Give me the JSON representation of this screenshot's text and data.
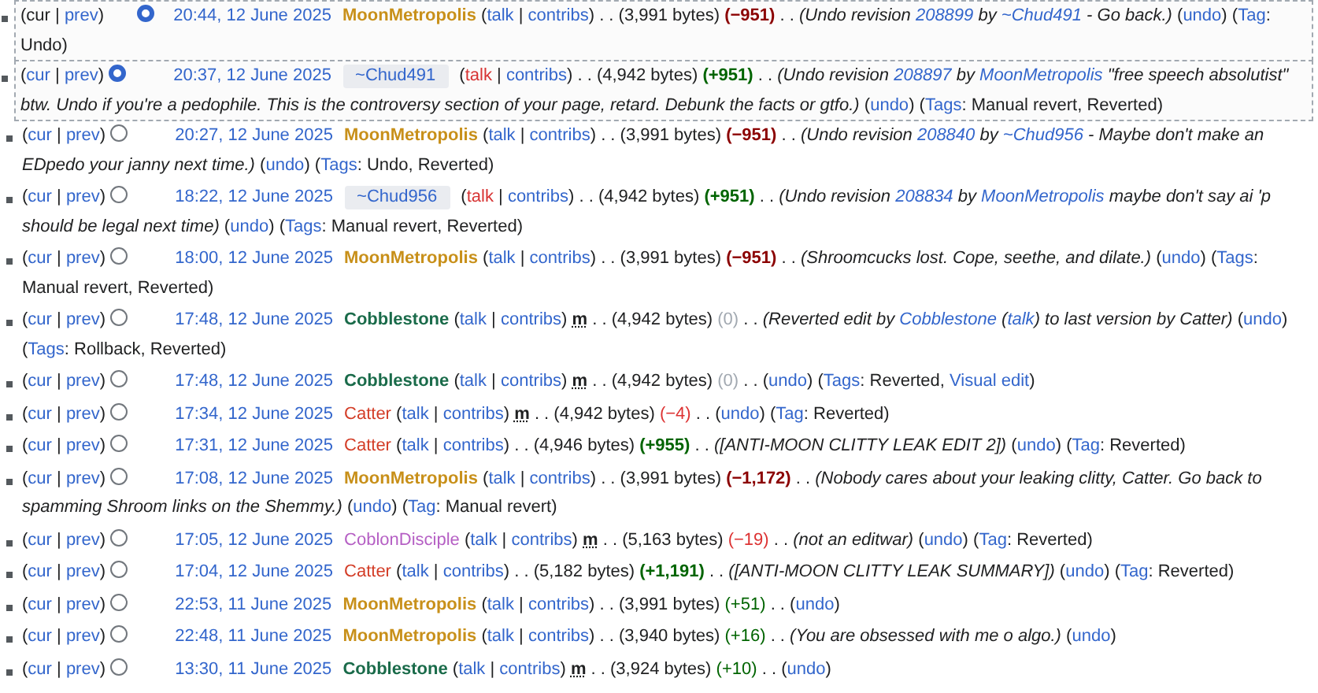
{
  "rows": [
    {
      "selected": true,
      "nav": [
        {
          "text": "(",
          "kind": "plain"
        },
        {
          "text": "cur",
          "kind": "plain"
        },
        {
          "text": " | ",
          "kind": "plain"
        },
        {
          "text": "prev",
          "kind": "link"
        },
        {
          "text": ")",
          "kind": "plain"
        }
      ],
      "radio_in_new_column": true,
      "radio_checked": true,
      "date": "20:44, 12 June 2025",
      "user": {
        "name": "MoonMetropolis",
        "kind": "registered",
        "color": "#c8901a"
      },
      "tools": [
        {
          "text": "(",
          "kind": "plain"
        },
        {
          "text": "talk",
          "kind": "link"
        },
        {
          "text": " | ",
          "kind": "plain"
        },
        {
          "text": "contribs",
          "kind": "link"
        },
        {
          "text": ")",
          "kind": "plain"
        }
      ],
      "separators": [
        ". .",
        ". ."
      ],
      "size": "(3,991 bytes)",
      "diff": {
        "text": "(−951)",
        "kind": "negative",
        "big": true
      },
      "summary": [
        {
          "text": "(Undo revision ",
          "kind": "plain"
        },
        {
          "text": "208899",
          "kind": "link"
        },
        {
          "text": " by ",
          "kind": "plain"
        },
        {
          "text": "~Chud491",
          "kind": "link"
        },
        {
          "text": " - Go back.)",
          "kind": "plain"
        }
      ],
      "undo": [
        {
          "text": "(",
          "kind": "plain"
        },
        {
          "text": "undo",
          "kind": "link"
        },
        {
          "text": ")",
          "kind": "plain"
        }
      ],
      "tags": [
        {
          "text": "(",
          "kind": "plain"
        },
        {
          "text": "Tag",
          "kind": "link"
        },
        {
          "text": ": Undo)",
          "kind": "plain"
        }
      ]
    },
    {
      "selected": true,
      "nav": [
        {
          "text": "(",
          "kind": "plain"
        },
        {
          "text": "cur",
          "kind": "link"
        },
        {
          "text": " | ",
          "kind": "plain"
        },
        {
          "text": "prev",
          "kind": "link"
        },
        {
          "text": ")",
          "kind": "plain"
        }
      ],
      "radio_in_new_column": false,
      "radio_checked": true,
      "date": "20:37, 12 June 2025",
      "user": {
        "name": "~Chud491",
        "kind": "temporary",
        "color": "#3366cc"
      },
      "tools": [
        {
          "text": "(",
          "kind": "plain"
        },
        {
          "text": "talk",
          "kind": "redlink"
        },
        {
          "text": " | ",
          "kind": "plain"
        },
        {
          "text": "contribs",
          "kind": "link"
        },
        {
          "text": ")",
          "kind": "plain"
        }
      ],
      "separators": [
        ". .",
        ". ."
      ],
      "size": "(4,942 bytes)",
      "diff": {
        "text": "(+951)",
        "kind": "positive",
        "big": true
      },
      "summary": [
        {
          "text": "(Undo revision ",
          "kind": "plain"
        },
        {
          "text": "208897",
          "kind": "link"
        },
        {
          "text": " by ",
          "kind": "plain"
        },
        {
          "text": "MoonMetropolis",
          "kind": "link"
        },
        {
          "text": " \"free speech absolutist\" btw. Undo if you're a pedophile. This is the controversy section of your page, retard. Debunk the facts or gtfo.)",
          "kind": "plain"
        }
      ],
      "undo": [
        {
          "text": "(",
          "kind": "plain"
        },
        {
          "text": "undo",
          "kind": "link"
        },
        {
          "text": ")",
          "kind": "plain"
        }
      ],
      "tags": [
        {
          "text": "(",
          "kind": "plain"
        },
        {
          "text": "Tags",
          "kind": "link"
        },
        {
          "text": ": Manual revert, Reverted)",
          "kind": "plain"
        }
      ]
    },
    {
      "selected": false,
      "nav": [
        {
          "text": "(",
          "kind": "plain"
        },
        {
          "text": "cur",
          "kind": "link"
        },
        {
          "text": " | ",
          "kind": "plain"
        },
        {
          "text": "prev",
          "kind": "link"
        },
        {
          "text": ")",
          "kind": "plain"
        }
      ],
      "radio_in_new_column": false,
      "radio_checked": false,
      "date": "20:27, 12 June 2025",
      "user": {
        "name": "MoonMetropolis",
        "kind": "registered",
        "color": "#c8901a"
      },
      "tools": [
        {
          "text": "(",
          "kind": "plain"
        },
        {
          "text": "talk",
          "kind": "link"
        },
        {
          "text": " | ",
          "kind": "plain"
        },
        {
          "text": "contribs",
          "kind": "link"
        },
        {
          "text": ")",
          "kind": "plain"
        }
      ],
      "separators": [
        ". .",
        ". ."
      ],
      "size": "(3,991 bytes)",
      "diff": {
        "text": "(−951)",
        "kind": "negative",
        "big": true
      },
      "summary": [
        {
          "text": "(Undo revision ",
          "kind": "plain"
        },
        {
          "text": "208840",
          "kind": "link"
        },
        {
          "text": " by ",
          "kind": "plain"
        },
        {
          "text": "~Chud956",
          "kind": "link"
        },
        {
          "text": " - Maybe don't make an EDpedo your janny next time.)",
          "kind": "plain"
        }
      ],
      "undo": [
        {
          "text": "(",
          "kind": "plain"
        },
        {
          "text": "undo",
          "kind": "link"
        },
        {
          "text": ")",
          "kind": "plain"
        }
      ],
      "tags": [
        {
          "text": "(",
          "kind": "plain"
        },
        {
          "text": "Tags",
          "kind": "link"
        },
        {
          "text": ": Undo, Reverted)",
          "kind": "plain"
        }
      ]
    },
    {
      "selected": false,
      "nav": [
        {
          "text": "(",
          "kind": "plain"
        },
        {
          "text": "cur",
          "kind": "link"
        },
        {
          "text": " | ",
          "kind": "plain"
        },
        {
          "text": "prev",
          "kind": "link"
        },
        {
          "text": ")",
          "kind": "plain"
        }
      ],
      "radio_in_new_column": false,
      "radio_checked": false,
      "date": "18:22, 12 June 2025",
      "user": {
        "name": "~Chud956",
        "kind": "temporary",
        "color": "#3366cc"
      },
      "tools": [
        {
          "text": "(",
          "kind": "plain"
        },
        {
          "text": "talk",
          "kind": "redlink"
        },
        {
          "text": " | ",
          "kind": "plain"
        },
        {
          "text": "contribs",
          "kind": "link"
        },
        {
          "text": ")",
          "kind": "plain"
        }
      ],
      "separators": [
        ". .",
        ". ."
      ],
      "size": "(4,942 bytes)",
      "diff": {
        "text": "(+951)",
        "kind": "positive",
        "big": true
      },
      "summary": [
        {
          "text": "(Undo revision ",
          "kind": "plain"
        },
        {
          "text": "208834",
          "kind": "link"
        },
        {
          "text": " by ",
          "kind": "plain"
        },
        {
          "text": "MoonMetropolis",
          "kind": "link"
        },
        {
          "text": " maybe don't say ai 'p should be legal next time)",
          "kind": "plain"
        }
      ],
      "undo": [
        {
          "text": "(",
          "kind": "plain"
        },
        {
          "text": "undo",
          "kind": "link"
        },
        {
          "text": ")",
          "kind": "plain"
        }
      ],
      "tags": [
        {
          "text": "(",
          "kind": "plain"
        },
        {
          "text": "Tags",
          "kind": "link"
        },
        {
          "text": ": Manual revert, Reverted)",
          "kind": "plain"
        }
      ]
    },
    {
      "selected": false,
      "nav": [
        {
          "text": "(",
          "kind": "plain"
        },
        {
          "text": "cur",
          "kind": "link"
        },
        {
          "text": " | ",
          "kind": "plain"
        },
        {
          "text": "prev",
          "kind": "link"
        },
        {
          "text": ")",
          "kind": "plain"
        }
      ],
      "radio_in_new_column": false,
      "radio_checked": false,
      "date": "18:00, 12 June 2025",
      "user": {
        "name": "MoonMetropolis",
        "kind": "registered",
        "color": "#c8901a"
      },
      "tools": [
        {
          "text": "(",
          "kind": "plain"
        },
        {
          "text": "talk",
          "kind": "link"
        },
        {
          "text": " | ",
          "kind": "plain"
        },
        {
          "text": "contribs",
          "kind": "link"
        },
        {
          "text": ")",
          "kind": "plain"
        }
      ],
      "separators": [
        ". .",
        ". ."
      ],
      "size": "(3,991 bytes)",
      "diff": {
        "text": "(−951)",
        "kind": "negative",
        "big": true
      },
      "summary": [
        {
          "text": "(Shroomcucks lost. Cope, seethe, and dilate.)",
          "kind": "plain"
        }
      ],
      "undo": [
        {
          "text": "(",
          "kind": "plain"
        },
        {
          "text": "undo",
          "kind": "link"
        },
        {
          "text": ")",
          "kind": "plain"
        }
      ],
      "tags": [
        {
          "text": "(",
          "kind": "plain"
        },
        {
          "text": "Tags",
          "kind": "link"
        },
        {
          "text": ": Manual revert, Reverted)",
          "kind": "plain"
        }
      ]
    },
    {
      "selected": false,
      "nav": [
        {
          "text": "(",
          "kind": "plain"
        },
        {
          "text": "cur",
          "kind": "link"
        },
        {
          "text": " | ",
          "kind": "plain"
        },
        {
          "text": "prev",
          "kind": "link"
        },
        {
          "text": ")",
          "kind": "plain"
        }
      ],
      "radio_in_new_column": false,
      "radio_checked": false,
      "date": "17:48, 12 June 2025",
      "user": {
        "name": "Cobblestone",
        "kind": "registered",
        "color": "#1a6b4a"
      },
      "tools": [
        {
          "text": "(",
          "kind": "plain"
        },
        {
          "text": "talk",
          "kind": "link"
        },
        {
          "text": " | ",
          "kind": "plain"
        },
        {
          "text": "contribs",
          "kind": "link"
        },
        {
          "text": ")",
          "kind": "plain"
        }
      ],
      "minor": "m",
      "separators": [
        ". .",
        ". ."
      ],
      "size": "(4,942 bytes)",
      "diff": {
        "text": "(0)",
        "kind": "zero",
        "big": false
      },
      "summary": [
        {
          "text": "(Reverted edit by ",
          "kind": "plain"
        },
        {
          "text": "Cobblestone",
          "kind": "link"
        },
        {
          "text": " (",
          "kind": "plain"
        },
        {
          "text": "talk",
          "kind": "link"
        },
        {
          "text": ") to last version by Catter)",
          "kind": "plain"
        }
      ],
      "undo": [
        {
          "text": "(",
          "kind": "plain"
        },
        {
          "text": "undo",
          "kind": "link"
        },
        {
          "text": ")",
          "kind": "plain"
        }
      ],
      "tags": [
        {
          "text": "(",
          "kind": "plain"
        },
        {
          "text": "Tags",
          "kind": "link"
        },
        {
          "text": ": Rollback, Reverted)",
          "kind": "plain"
        }
      ]
    },
    {
      "selected": false,
      "nav": [
        {
          "text": "(",
          "kind": "plain"
        },
        {
          "text": "cur",
          "kind": "link"
        },
        {
          "text": " | ",
          "kind": "plain"
        },
        {
          "text": "prev",
          "kind": "link"
        },
        {
          "text": ")",
          "kind": "plain"
        }
      ],
      "radio_in_new_column": false,
      "radio_checked": false,
      "date": "17:48, 12 June 2025",
      "user": {
        "name": "Cobblestone",
        "kind": "registered",
        "color": "#1a6b4a"
      },
      "tools": [
        {
          "text": "(",
          "kind": "plain"
        },
        {
          "text": "talk",
          "kind": "link"
        },
        {
          "text": " | ",
          "kind": "plain"
        },
        {
          "text": "contribs",
          "kind": "link"
        },
        {
          "text": ")",
          "kind": "plain"
        }
      ],
      "minor": "m",
      "separators": [
        ". .",
        ". ."
      ],
      "size": "(4,942 bytes)",
      "diff": {
        "text": "(0)",
        "kind": "zero",
        "big": false
      },
      "undo": [
        {
          "text": "(",
          "kind": "plain"
        },
        {
          "text": "undo",
          "kind": "link"
        },
        {
          "text": ")",
          "kind": "plain"
        }
      ],
      "tags": [
        {
          "text": "(",
          "kind": "plain"
        },
        {
          "text": "Tags",
          "kind": "link"
        },
        {
          "text": ": Reverted, ",
          "kind": "plain"
        },
        {
          "text": "Visual edit",
          "kind": "link"
        },
        {
          "text": ")",
          "kind": "plain"
        }
      ]
    },
    {
      "selected": false,
      "nav": [
        {
          "text": "(",
          "kind": "plain"
        },
        {
          "text": "cur",
          "kind": "link"
        },
        {
          "text": " | ",
          "kind": "plain"
        },
        {
          "text": "prev",
          "kind": "link"
        },
        {
          "text": ")",
          "kind": "plain"
        }
      ],
      "radio_in_new_column": false,
      "radio_checked": false,
      "date": "17:34, 12 June 2025",
      "user": {
        "name": "Catter",
        "kind": "plain",
        "color": "#d33c26"
      },
      "tools": [
        {
          "text": "(",
          "kind": "plain"
        },
        {
          "text": "talk",
          "kind": "link"
        },
        {
          "text": " | ",
          "kind": "plain"
        },
        {
          "text": "contribs",
          "kind": "link"
        },
        {
          "text": ")",
          "kind": "plain"
        }
      ],
      "minor": "m",
      "separators": [
        ". .",
        ". ."
      ],
      "size": "(4,942 bytes)",
      "diff": {
        "text": "(−4)",
        "kind": "negative",
        "big": false
      },
      "undo": [
        {
          "text": "(",
          "kind": "plain"
        },
        {
          "text": "undo",
          "kind": "link"
        },
        {
          "text": ")",
          "kind": "plain"
        }
      ],
      "tags": [
        {
          "text": "(",
          "kind": "plain"
        },
        {
          "text": "Tag",
          "kind": "link"
        },
        {
          "text": ": Reverted)",
          "kind": "plain"
        }
      ]
    },
    {
      "selected": false,
      "nav": [
        {
          "text": "(",
          "kind": "plain"
        },
        {
          "text": "cur",
          "kind": "link"
        },
        {
          "text": " | ",
          "kind": "plain"
        },
        {
          "text": "prev",
          "kind": "link"
        },
        {
          "text": ")",
          "kind": "plain"
        }
      ],
      "radio_in_new_column": false,
      "radio_checked": false,
      "date": "17:31, 12 June 2025",
      "user": {
        "name": "Catter",
        "kind": "plain",
        "color": "#d33c26"
      },
      "tools": [
        {
          "text": "(",
          "kind": "plain"
        },
        {
          "text": "talk",
          "kind": "link"
        },
        {
          "text": " | ",
          "kind": "plain"
        },
        {
          "text": "contribs",
          "kind": "link"
        },
        {
          "text": ")",
          "kind": "plain"
        }
      ],
      "separators": [
        ". .",
        ". ."
      ],
      "size": "(4,946 bytes)",
      "diff": {
        "text": "(+955)",
        "kind": "positive",
        "big": true
      },
      "summary": [
        {
          "text": "([ANTI-MOON CLITTY LEAK EDIT 2])",
          "kind": "plain"
        }
      ],
      "undo": [
        {
          "text": "(",
          "kind": "plain"
        },
        {
          "text": "undo",
          "kind": "link"
        },
        {
          "text": ")",
          "kind": "plain"
        }
      ],
      "tags": [
        {
          "text": "(",
          "kind": "plain"
        },
        {
          "text": "Tag",
          "kind": "link"
        },
        {
          "text": ": Reverted)",
          "kind": "plain"
        }
      ]
    },
    {
      "selected": false,
      "nav": [
        {
          "text": "(",
          "kind": "plain"
        },
        {
          "text": "cur",
          "kind": "link"
        },
        {
          "text": " | ",
          "kind": "plain"
        },
        {
          "text": "prev",
          "kind": "link"
        },
        {
          "text": ")",
          "kind": "plain"
        }
      ],
      "radio_in_new_column": false,
      "radio_checked": false,
      "date": "17:08, 12 June 2025",
      "user": {
        "name": "MoonMetropolis",
        "kind": "registered",
        "color": "#c8901a"
      },
      "tools": [
        {
          "text": "(",
          "kind": "plain"
        },
        {
          "text": "talk",
          "kind": "link"
        },
        {
          "text": " | ",
          "kind": "plain"
        },
        {
          "text": "contribs",
          "kind": "link"
        },
        {
          "text": ")",
          "kind": "plain"
        }
      ],
      "separators": [
        ". .",
        ". ."
      ],
      "size": "(3,991 bytes)",
      "diff": {
        "text": "(−1,172)",
        "kind": "negative",
        "big": true
      },
      "summary": [
        {
          "text": "(Nobody cares about your leaking clitty, Catter. Go back to spamming Shroom links on the Shemmy.)",
          "kind": "plain"
        }
      ],
      "undo": [
        {
          "text": "(",
          "kind": "plain"
        },
        {
          "text": "undo",
          "kind": "link"
        },
        {
          "text": ")",
          "kind": "plain"
        }
      ],
      "tags": [
        {
          "text": "(",
          "kind": "plain"
        },
        {
          "text": "Tag",
          "kind": "link"
        },
        {
          "text": ": Manual revert)",
          "kind": "plain"
        }
      ]
    },
    {
      "selected": false,
      "nav": [
        {
          "text": "(",
          "kind": "plain"
        },
        {
          "text": "cur",
          "kind": "link"
        },
        {
          "text": " | ",
          "kind": "plain"
        },
        {
          "text": "prev",
          "kind": "link"
        },
        {
          "text": ")",
          "kind": "plain"
        }
      ],
      "radio_in_new_column": false,
      "radio_checked": false,
      "date": "17:05, 12 June 2025",
      "user": {
        "name": "CoblonDisciple",
        "kind": "plain",
        "color": "#b55fc4"
      },
      "tools": [
        {
          "text": "(",
          "kind": "plain"
        },
        {
          "text": "talk",
          "kind": "link"
        },
        {
          "text": " | ",
          "kind": "plain"
        },
        {
          "text": "contribs",
          "kind": "link"
        },
        {
          "text": ")",
          "kind": "plain"
        }
      ],
      "minor": "m",
      "separators": [
        ". .",
        ". ."
      ],
      "size": "(5,163 bytes)",
      "diff": {
        "text": "(−19)",
        "kind": "negative",
        "big": false
      },
      "summary": [
        {
          "text": "(not an editwar)",
          "kind": "plain"
        }
      ],
      "undo": [
        {
          "text": "(",
          "kind": "plain"
        },
        {
          "text": "undo",
          "kind": "link"
        },
        {
          "text": ")",
          "kind": "plain"
        }
      ],
      "tags": [
        {
          "text": "(",
          "kind": "plain"
        },
        {
          "text": "Tag",
          "kind": "link"
        },
        {
          "text": ": Reverted)",
          "kind": "plain"
        }
      ]
    },
    {
      "selected": false,
      "nav": [
        {
          "text": "(",
          "kind": "plain"
        },
        {
          "text": "cur",
          "kind": "link"
        },
        {
          "text": " | ",
          "kind": "plain"
        },
        {
          "text": "prev",
          "kind": "link"
        },
        {
          "text": ")",
          "kind": "plain"
        }
      ],
      "radio_in_new_column": false,
      "radio_checked": false,
      "date": "17:04, 12 June 2025",
      "user": {
        "name": "Catter",
        "kind": "plain",
        "color": "#d33c26"
      },
      "tools": [
        {
          "text": "(",
          "kind": "plain"
        },
        {
          "text": "talk",
          "kind": "link"
        },
        {
          "text": " | ",
          "kind": "plain"
        },
        {
          "text": "contribs",
          "kind": "link"
        },
        {
          "text": ")",
          "kind": "plain"
        }
      ],
      "separators": [
        ". .",
        ". ."
      ],
      "size": "(5,182 bytes)",
      "diff": {
        "text": "(+1,191)",
        "kind": "positive",
        "big": true
      },
      "summary": [
        {
          "text": "([ANTI-MOON CLITTY LEAK SUMMARY])",
          "kind": "plain"
        }
      ],
      "undo": [
        {
          "text": "(",
          "kind": "plain"
        },
        {
          "text": "undo",
          "kind": "link"
        },
        {
          "text": ")",
          "kind": "plain"
        }
      ],
      "tags": [
        {
          "text": "(",
          "kind": "plain"
        },
        {
          "text": "Tag",
          "kind": "link"
        },
        {
          "text": ": Reverted)",
          "kind": "plain"
        }
      ]
    },
    {
      "selected": false,
      "nav": [
        {
          "text": "(",
          "kind": "plain"
        },
        {
          "text": "cur",
          "kind": "link"
        },
        {
          "text": " | ",
          "kind": "plain"
        },
        {
          "text": "prev",
          "kind": "link"
        },
        {
          "text": ")",
          "kind": "plain"
        }
      ],
      "radio_in_new_column": false,
      "radio_checked": false,
      "date": "22:53, 11 June 2025",
      "user": {
        "name": "MoonMetropolis",
        "kind": "registered",
        "color": "#c8901a"
      },
      "tools": [
        {
          "text": "(",
          "kind": "plain"
        },
        {
          "text": "talk",
          "kind": "link"
        },
        {
          "text": " | ",
          "kind": "plain"
        },
        {
          "text": "contribs",
          "kind": "link"
        },
        {
          "text": ")",
          "kind": "plain"
        }
      ],
      "separators": [
        ". .",
        ". ."
      ],
      "size": "(3,991 bytes)",
      "diff": {
        "text": "(+51)",
        "kind": "positive",
        "big": false
      },
      "undo": [
        {
          "text": "(",
          "kind": "plain"
        },
        {
          "text": "undo",
          "kind": "link"
        },
        {
          "text": ")",
          "kind": "plain"
        }
      ]
    },
    {
      "selected": false,
      "nav": [
        {
          "text": "(",
          "kind": "plain"
        },
        {
          "text": "cur",
          "kind": "link"
        },
        {
          "text": " | ",
          "kind": "plain"
        },
        {
          "text": "prev",
          "kind": "link"
        },
        {
          "text": ")",
          "kind": "plain"
        }
      ],
      "radio_in_new_column": false,
      "radio_checked": false,
      "date": "22:48, 11 June 2025",
      "user": {
        "name": "MoonMetropolis",
        "kind": "registered",
        "color": "#c8901a"
      },
      "tools": [
        {
          "text": "(",
          "kind": "plain"
        },
        {
          "text": "talk",
          "kind": "link"
        },
        {
          "text": " | ",
          "kind": "plain"
        },
        {
          "text": "contribs",
          "kind": "link"
        },
        {
          "text": ")",
          "kind": "plain"
        }
      ],
      "separators": [
        ". .",
        ". ."
      ],
      "size": "(3,940 bytes)",
      "diff": {
        "text": "(+16)",
        "kind": "positive",
        "big": false
      },
      "summary": [
        {
          "text": "(You are obsessed with me o algo.)",
          "kind": "plain"
        }
      ],
      "undo": [
        {
          "text": "(",
          "kind": "plain"
        },
        {
          "text": "undo",
          "kind": "link"
        },
        {
          "text": ")",
          "kind": "plain"
        }
      ]
    },
    {
      "selected": false,
      "nav": [
        {
          "text": "(",
          "kind": "plain"
        },
        {
          "text": "cur",
          "kind": "link"
        },
        {
          "text": " | ",
          "kind": "plain"
        },
        {
          "text": "prev",
          "kind": "link"
        },
        {
          "text": ")",
          "kind": "plain"
        }
      ],
      "radio_in_new_column": false,
      "radio_checked": false,
      "date": "13:30, 11 June 2025",
      "user": {
        "name": "Cobblestone",
        "kind": "registered",
        "color": "#1a6b4a"
      },
      "tools": [
        {
          "text": "(",
          "kind": "plain"
        },
        {
          "text": "talk",
          "kind": "link"
        },
        {
          "text": " | ",
          "kind": "plain"
        },
        {
          "text": "contribs",
          "kind": "link"
        },
        {
          "text": ")",
          "kind": "plain"
        }
      ],
      "minor": "m",
      "separators": [
        ". .",
        ". ."
      ],
      "size": "(3,924 bytes)",
      "diff": {
        "text": "(+10)",
        "kind": "positive",
        "big": false
      },
      "undo": [
        {
          "text": "(",
          "kind": "plain"
        },
        {
          "text": "undo",
          "kind": "link"
        },
        {
          "text": ")",
          "kind": "plain"
        }
      ]
    }
  ]
}
